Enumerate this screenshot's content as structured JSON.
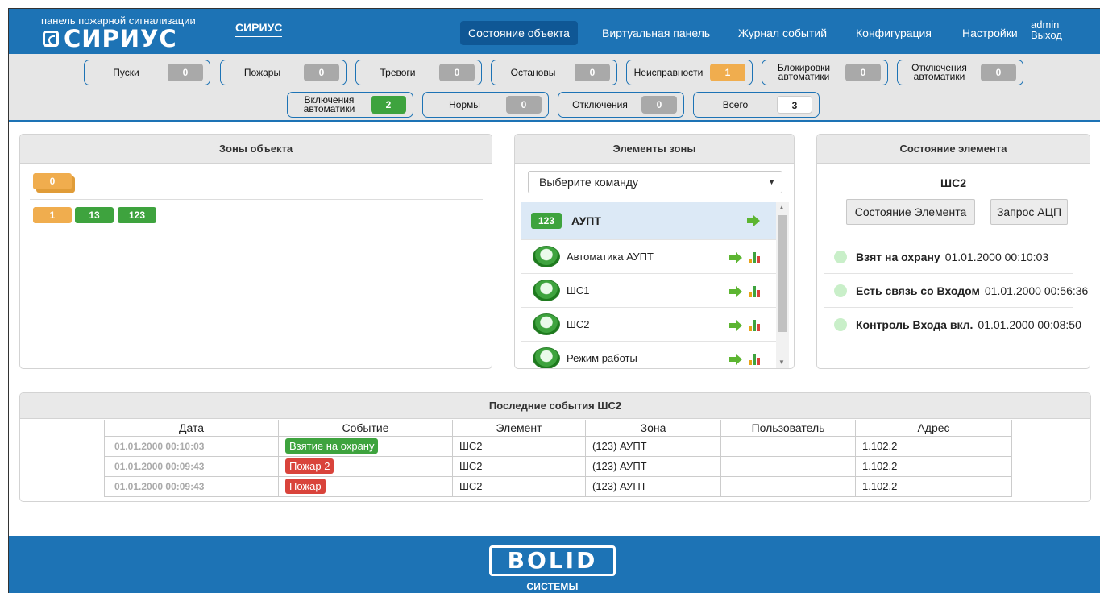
{
  "header": {
    "subtitle": "панель пожарной сигнализации",
    "logo_text": "СИРИУС",
    "system_name": "СИРИУС",
    "nav": [
      "Состояние объекта",
      "Виртуальная панель",
      "Журнал событий",
      "Конфигурация",
      "Настройки"
    ],
    "user_name": "admin",
    "logout": "Выход"
  },
  "counters": [
    {
      "label": "Пуски",
      "value": "0",
      "color": "gray"
    },
    {
      "label": "Пожары",
      "value": "0",
      "color": "gray"
    },
    {
      "label": "Тревоги",
      "value": "0",
      "color": "gray"
    },
    {
      "label": "Останoвы",
      "value": "0",
      "color": "gray"
    },
    {
      "label": "Неисправности",
      "value": "1",
      "color": "orange"
    },
    {
      "label": "Блокировки автоматики",
      "value": "0",
      "color": "gray"
    },
    {
      "label": "Отключения автоматики",
      "value": "0",
      "color": "gray"
    },
    {
      "label": "Включения автоматики",
      "value": "2",
      "color": "green"
    },
    {
      "label": "Нормы",
      "value": "0",
      "color": "gray"
    },
    {
      "label": "Отключения",
      "value": "0",
      "color": "gray"
    },
    {
      "label": "Всего",
      "value": "3",
      "color": "white"
    }
  ],
  "zones_panel": {
    "title": "Зоны объекта",
    "group_badge": "0",
    "zones": [
      "1",
      "13",
      "123"
    ]
  },
  "elements_panel": {
    "title": "Элементы зоны",
    "select_value": "Выберите команду",
    "zone_badge": "123",
    "zone_name": "АУПТ",
    "items": [
      "Автоматика АУПТ",
      "ШС1",
      "ШС2",
      "Режим работы"
    ]
  },
  "state_panel": {
    "title": "Состояние элемента",
    "element": "ШС2",
    "buttons": [
      "Состояние Элемента",
      "Запрос АЦП"
    ],
    "rows": [
      {
        "name": "Взят на охрану",
        "time": "01.01.2000 00:10:03"
      },
      {
        "name": "Есть связь со Входом",
        "time": "01.01.2000 00:56:36"
      },
      {
        "name": "Контроль Входа вкл.",
        "time": "01.01.2000 00:08:50"
      }
    ]
  },
  "events": {
    "title": "Последние события ШС2",
    "columns": [
      "Дата",
      "Событие",
      "Элемент",
      "Зона",
      "Пользователь",
      "Адрес"
    ],
    "rows": [
      {
        "date": "01.01.2000 00:10:03",
        "event": "Взятие на охрану",
        "event_color": "green",
        "element": "ШС2",
        "zone": "(123) АУПТ",
        "user": "",
        "address": "1.102.2"
      },
      {
        "date": "01.01.2000 00:09:43",
        "event": "Пожар 2",
        "event_color": "red",
        "element": "ШС2",
        "zone": "(123) АУПТ",
        "user": "",
        "address": "1.102.2"
      },
      {
        "date": "01.01.2000 00:09:43",
        "event": "Пожар",
        "event_color": "red",
        "element": "ШС2",
        "zone": "(123) АУПТ",
        "user": "",
        "address": "1.102.2"
      }
    ]
  },
  "footer": {
    "brand": "BOLID",
    "tagline": "СИСТЕМЫ БЕЗОПАСНОСТИ"
  },
  "colors": {
    "brand_blue": "#1d73b5",
    "nav_active": "#0f5795",
    "green": "#3ea33e",
    "orange": "#f0ad4e",
    "red": "#d9433b"
  }
}
